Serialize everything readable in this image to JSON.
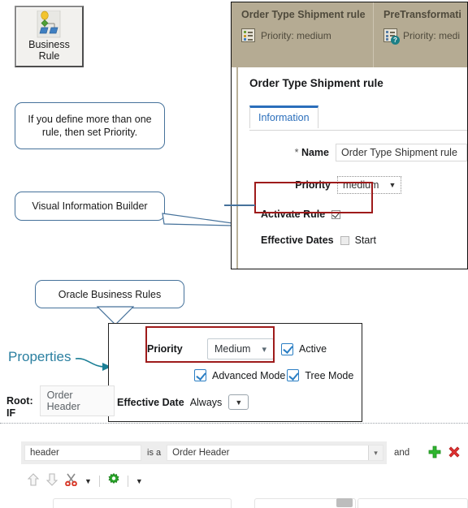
{
  "palette": {
    "tile_label_line1": "Business",
    "tile_label_line2": "Rule",
    "icon": "business-rule-icon"
  },
  "callouts": {
    "priority_note": "If you define more than one rule, then set Priority.",
    "vib": "Visual Information Builder",
    "obr": "Oracle Business Rules"
  },
  "annotations": {
    "properties": "Properties"
  },
  "vib_panel": {
    "cards": [
      {
        "title": "Order Type Shipment rule",
        "priority": "Priority: medium",
        "icon": "rule-list-icon"
      },
      {
        "title": "PreTransformati",
        "priority": "Priority: medi",
        "icon": "rule-list-help-icon"
      }
    ],
    "dialog": {
      "title": "Order Type Shipment rule",
      "tabs": [
        {
          "label": "Information",
          "active": true
        }
      ],
      "fields": {
        "name_label": "Name",
        "name_required_marker": "*",
        "name_value": "Order Type Shipment rule",
        "priority_label": "Priority",
        "priority_value": "medium",
        "activate_label": "Activate Rule",
        "activate_checked": true,
        "effective_dates_label": "Effective Dates",
        "effective_start_label": "Start",
        "effective_start_checked": false
      }
    }
  },
  "properties_panel": {
    "priority_label": "Priority",
    "priority_value": "Medium",
    "active_label": "Active",
    "active_checked": true,
    "advanced_mode_label": "Advanced Mode",
    "advanced_mode_checked": true,
    "tree_mode_label": "Tree Mode",
    "tree_mode_checked": true,
    "effective_date_label": "Effective Date",
    "effective_date_value": "Always",
    "effective_date_dropdown": "dropdown-caret-icon"
  },
  "rule_editor": {
    "root_label": "Root:",
    "root_value": "Order Header",
    "if_label": "IF",
    "condition": {
      "variable": "header",
      "operator": "is a",
      "type_value": "Order Header",
      "conjunction": "and",
      "add_icon": "add-icon",
      "delete_icon": "delete-icon"
    },
    "toolbar": [
      {
        "name": "move-up-icon"
      },
      {
        "name": "move-down-icon"
      },
      {
        "name": "cut-icon"
      },
      {
        "name": "cut-menu-caret-icon"
      },
      {
        "name": "settings-gear-icon"
      },
      {
        "name": "settings-menu-caret-icon"
      }
    ]
  },
  "colors": {
    "card_background": "#b5ab93",
    "highlight_red": "#9e1b1b",
    "callout_border": "#46729b",
    "annotation_teal": "#2a7fa0",
    "tab_accent": "#2a6ebb",
    "checkbox_blue": "#2a7ec4",
    "add_green": "#2fb62f",
    "delete_red": "#e03131"
  }
}
